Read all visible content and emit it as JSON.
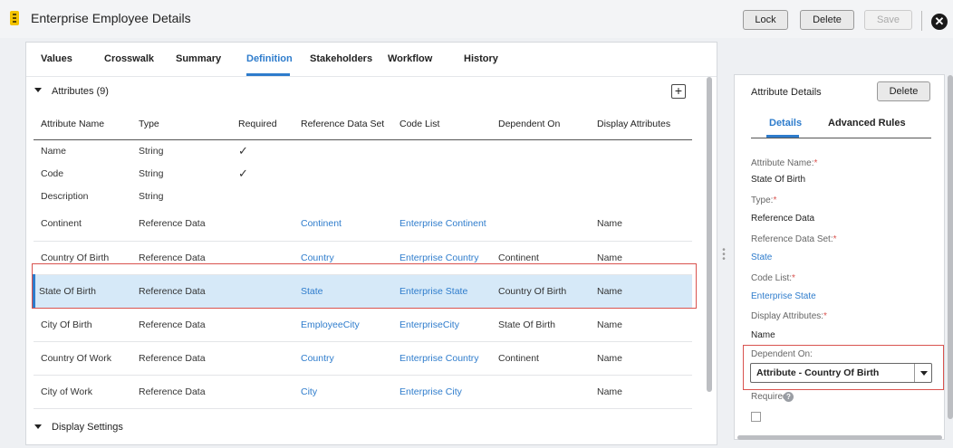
{
  "app": {
    "title": "Enterprise Employee Details",
    "icon": "document-icon"
  },
  "toolbar": {
    "lock_label": "Lock",
    "delete_label": "Delete",
    "save_label": "Save",
    "close_icon": "close-icon"
  },
  "tabs": [
    {
      "label": "Values"
    },
    {
      "label": "Crosswalk"
    },
    {
      "label": "Summary"
    },
    {
      "label": "Definition",
      "active": true
    },
    {
      "label": "Stakeholders"
    },
    {
      "label": "Workflow"
    },
    {
      "label": "History"
    }
  ],
  "attributes_section": {
    "title": "Attributes (9)",
    "add_label": "+"
  },
  "table": {
    "headers": [
      "Attribute Name",
      "Type",
      "Required",
      "Reference Data Set",
      "Code List",
      "Dependent On",
      "Display Attributes"
    ],
    "rows": [
      {
        "name": "Name",
        "type": "String",
        "required": "✓",
        "ref_set": "",
        "code_list": "",
        "dependent_on": "",
        "display": ""
      },
      {
        "name": "Code",
        "type": "String",
        "required": "✓",
        "ref_set": "",
        "code_list": "",
        "dependent_on": "",
        "display": ""
      },
      {
        "name": "Description",
        "type": "String",
        "required": "",
        "ref_set": "",
        "code_list": "",
        "dependent_on": "",
        "display": ""
      },
      {
        "name": "Continent",
        "type": "Reference Data",
        "required": "",
        "ref_set": "Continent",
        "code_list": "Enterprise Continent",
        "dependent_on": "",
        "display": "Name"
      },
      {
        "name": "Country Of Birth",
        "type": "Reference Data",
        "required": "",
        "ref_set": "Country",
        "code_list": "Enterprise Country",
        "dependent_on": "Continent",
        "display": "Name"
      },
      {
        "name": "State Of Birth",
        "type": "Reference Data",
        "required": "",
        "ref_set": "State",
        "code_list": "Enterprise State",
        "dependent_on": "Country Of Birth",
        "display": "Name",
        "selected": true
      },
      {
        "name": "City Of Birth",
        "type": "Reference Data",
        "required": "",
        "ref_set": "EmployeeCity",
        "code_list": "EnterpriseCity",
        "dependent_on": "State Of Birth",
        "display": "Name"
      },
      {
        "name": "Country Of Work",
        "type": "Reference Data",
        "required": "",
        "ref_set": "Country",
        "code_list": "Enterprise Country",
        "dependent_on": "Continent",
        "display": "Name"
      },
      {
        "name": "City of Work",
        "type": "Reference Data",
        "required": "",
        "ref_set": "City",
        "code_list": "Enterprise City",
        "dependent_on": "",
        "display": "Name"
      }
    ]
  },
  "display_settings": {
    "title": "Display Settings"
  },
  "details_panel": {
    "title": "Attribute Details",
    "delete_label": "Delete",
    "tabs": [
      {
        "label": "Details",
        "active": true
      },
      {
        "label": "Advanced Rules"
      }
    ],
    "fields": {
      "name_label": "Attribute Name:",
      "name_value": "State Of Birth",
      "type_label": "Type:",
      "type_value": "Reference Data",
      "ref_set_label": "Reference Data Set:",
      "ref_set_value": "State",
      "code_list_label": "Code List:",
      "code_list_value": "Enterprise State",
      "display_label": "Display Attributes:",
      "display_value": "Name",
      "dependent_label": "Dependent On:",
      "dependent_value": "Attribute - Country Of Birth",
      "required_label": "Required:",
      "required_marker": "*",
      "required_checked": false
    }
  },
  "colors": {
    "accent": "#2e7ccc",
    "selected_row": "#d6e9f8",
    "highlight_frame": "#d9534f",
    "required_star": "#d9534f",
    "app_icon": "#f3c300"
  }
}
